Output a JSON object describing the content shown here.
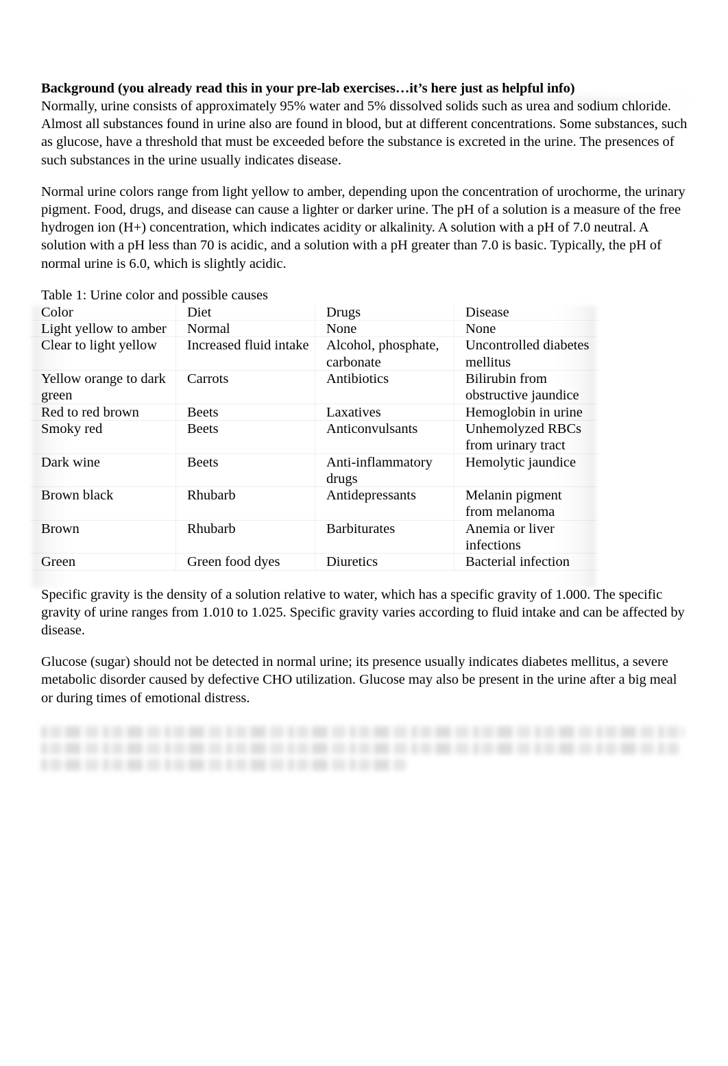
{
  "document": {
    "heading": "Background (you already read this in your pre-lab exercises…it’s here just as helpful info)",
    "paragraph_1": "Normally, urine consists of approximately 95% water and 5% dissolved solids such as urea and sodium chloride.  Almost all substances found in urine also are found in blood, but at different concentrations.  Some substances, such as glucose, have a threshold that must be exceeded before the substance is excreted in the urine.  The presences of such substances in the urine usually indicates disease.",
    "paragraph_2": "Normal urine colors range from light yellow to amber, depending upon the concentration of urochorme, the urinary pigment.  Food, drugs, and disease can cause a lighter or darker urine.  The pH of a solution is a measure of the free hydrogen ion (H+) concentration, which indicates acidity or alkalinity.  A solution with a pH of 7.0 neutral.  A solution with a pH less than 70 is acidic, and a solution with a pH greater than 7.0 is basic.  Typically, the pH of normal urine is 6.0, which is slightly acidic.",
    "paragraph_3": "Specific gravity is the density of a solution relative to water, which has a specific gravity of 1.000.  The specific gravity of urine ranges from 1.010 to 1.025.  Specific gravity varies according to fluid intake and can be affected by disease.",
    "paragraph_4": "Glucose (sugar) should not be detected in normal urine; its presence usually indicates diabetes mellitus, a severe metabolic disorder caused by defective CHO utilization.  Glucose may also be present in the urine after a big meal or during times of emotional distress.",
    "obscured_paragraph": {
      "legible": false,
      "note": "three-line paragraph rendered illegibly blurred in the screenshot",
      "lines": [
        "",
        "",
        ""
      ]
    }
  },
  "table": {
    "caption": "Table 1:  Urine color and possible causes",
    "columns": [
      "Color",
      "Diet",
      "Drugs",
      "Disease"
    ],
    "rows": [
      [
        "Light yellow to amber",
        "Normal",
        "None",
        "None"
      ],
      [
        "Clear to light yellow",
        "Increased fluid intake",
        "Alcohol, phosphate, carbonate",
        "Uncontrolled diabetes mellitus"
      ],
      [
        "Yellow orange to dark green",
        "Carrots",
        "Antibiotics",
        "Bilirubin from obstructive jaundice"
      ],
      [
        "Red to red brown",
        "Beets",
        "Laxatives",
        "Hemoglobin in urine"
      ],
      [
        "Smoky red",
        "Beets",
        "Anticonvulsants",
        "Unhemolyzed RBCs from urinary tract"
      ],
      [
        "Dark wine",
        "Beets",
        "Anti-inflammatory drugs",
        "Hemolytic jaundice"
      ],
      [
        "Brown black",
        "Rhubarb",
        "Antidepressants",
        "Melanin pigment from melanoma"
      ],
      [
        "Brown",
        "Rhubarb",
        "Barbiturates",
        "Anemia or liver infections"
      ],
      [
        "Green",
        "Green food dyes",
        "Diuretics",
        "Bacterial infection"
      ]
    ]
  },
  "colors": {
    "page_background": "#ffffff",
    "text": "#000000",
    "table_shading": "#d8d8d8"
  }
}
